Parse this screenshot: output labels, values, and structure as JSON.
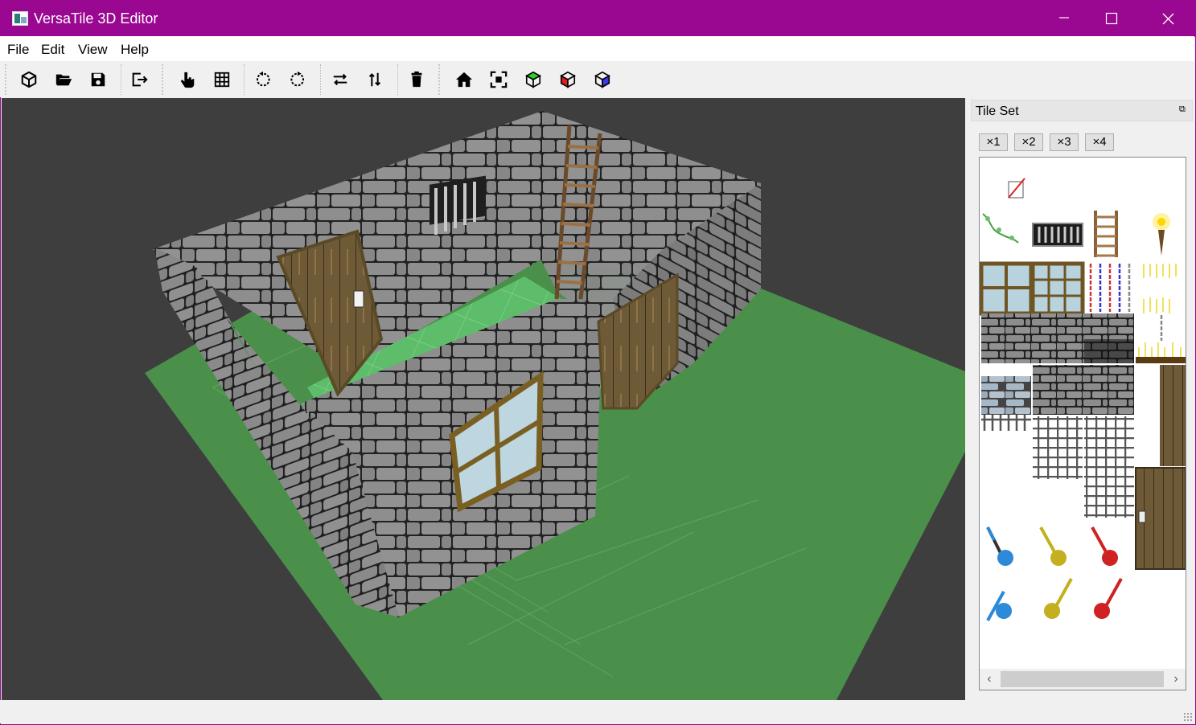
{
  "window": {
    "title": "VersaTile 3D Editor",
    "title_bar_color": "#9a0790",
    "controls": [
      "minimize-icon",
      "maximize-icon",
      "close-icon"
    ]
  },
  "menu": {
    "items": [
      "File",
      "Edit",
      "View",
      "Help"
    ]
  },
  "toolbar": {
    "groups": [
      [
        "new-cube-icon",
        "open-folder-icon",
        "save-disk-icon",
        "export-icon"
      ],
      [
        "hand-pointer-icon",
        "grid-icon",
        "rotate-left-icon",
        "rotate-right-icon",
        "flip-horizontal-icon",
        "flip-vertical-icon",
        "delete-trash-icon"
      ],
      [
        "home-icon",
        "frame-selection-icon",
        "view-cube-green-icon",
        "view-cube-red-icon",
        "view-cube-blue-icon"
      ]
    ]
  },
  "viewport": {
    "background": "#3e3e3e",
    "ground_color": "#4a8f4a",
    "floor_color": "#5fbd6a",
    "wall_color": "#8a8a8a"
  },
  "tileset": {
    "title": "Tile Set",
    "zoom_buttons": [
      "×1",
      "×2",
      "×3",
      "×4"
    ],
    "tiles": [
      "eraser-icon",
      "ivy-tile",
      "window-bars-tile",
      "ladder-tile",
      "torch-tile",
      "window-frame-tile",
      "window-frame-small-tile",
      "chain-tile",
      "light-rays-tile",
      "stone-brick-tile",
      "dark-brick-tile",
      "blue-brick-tile",
      "iron-grate-tile",
      "door-tile",
      "key-blue-icon",
      "key-yellow-icon",
      "key-red-icon"
    ]
  }
}
